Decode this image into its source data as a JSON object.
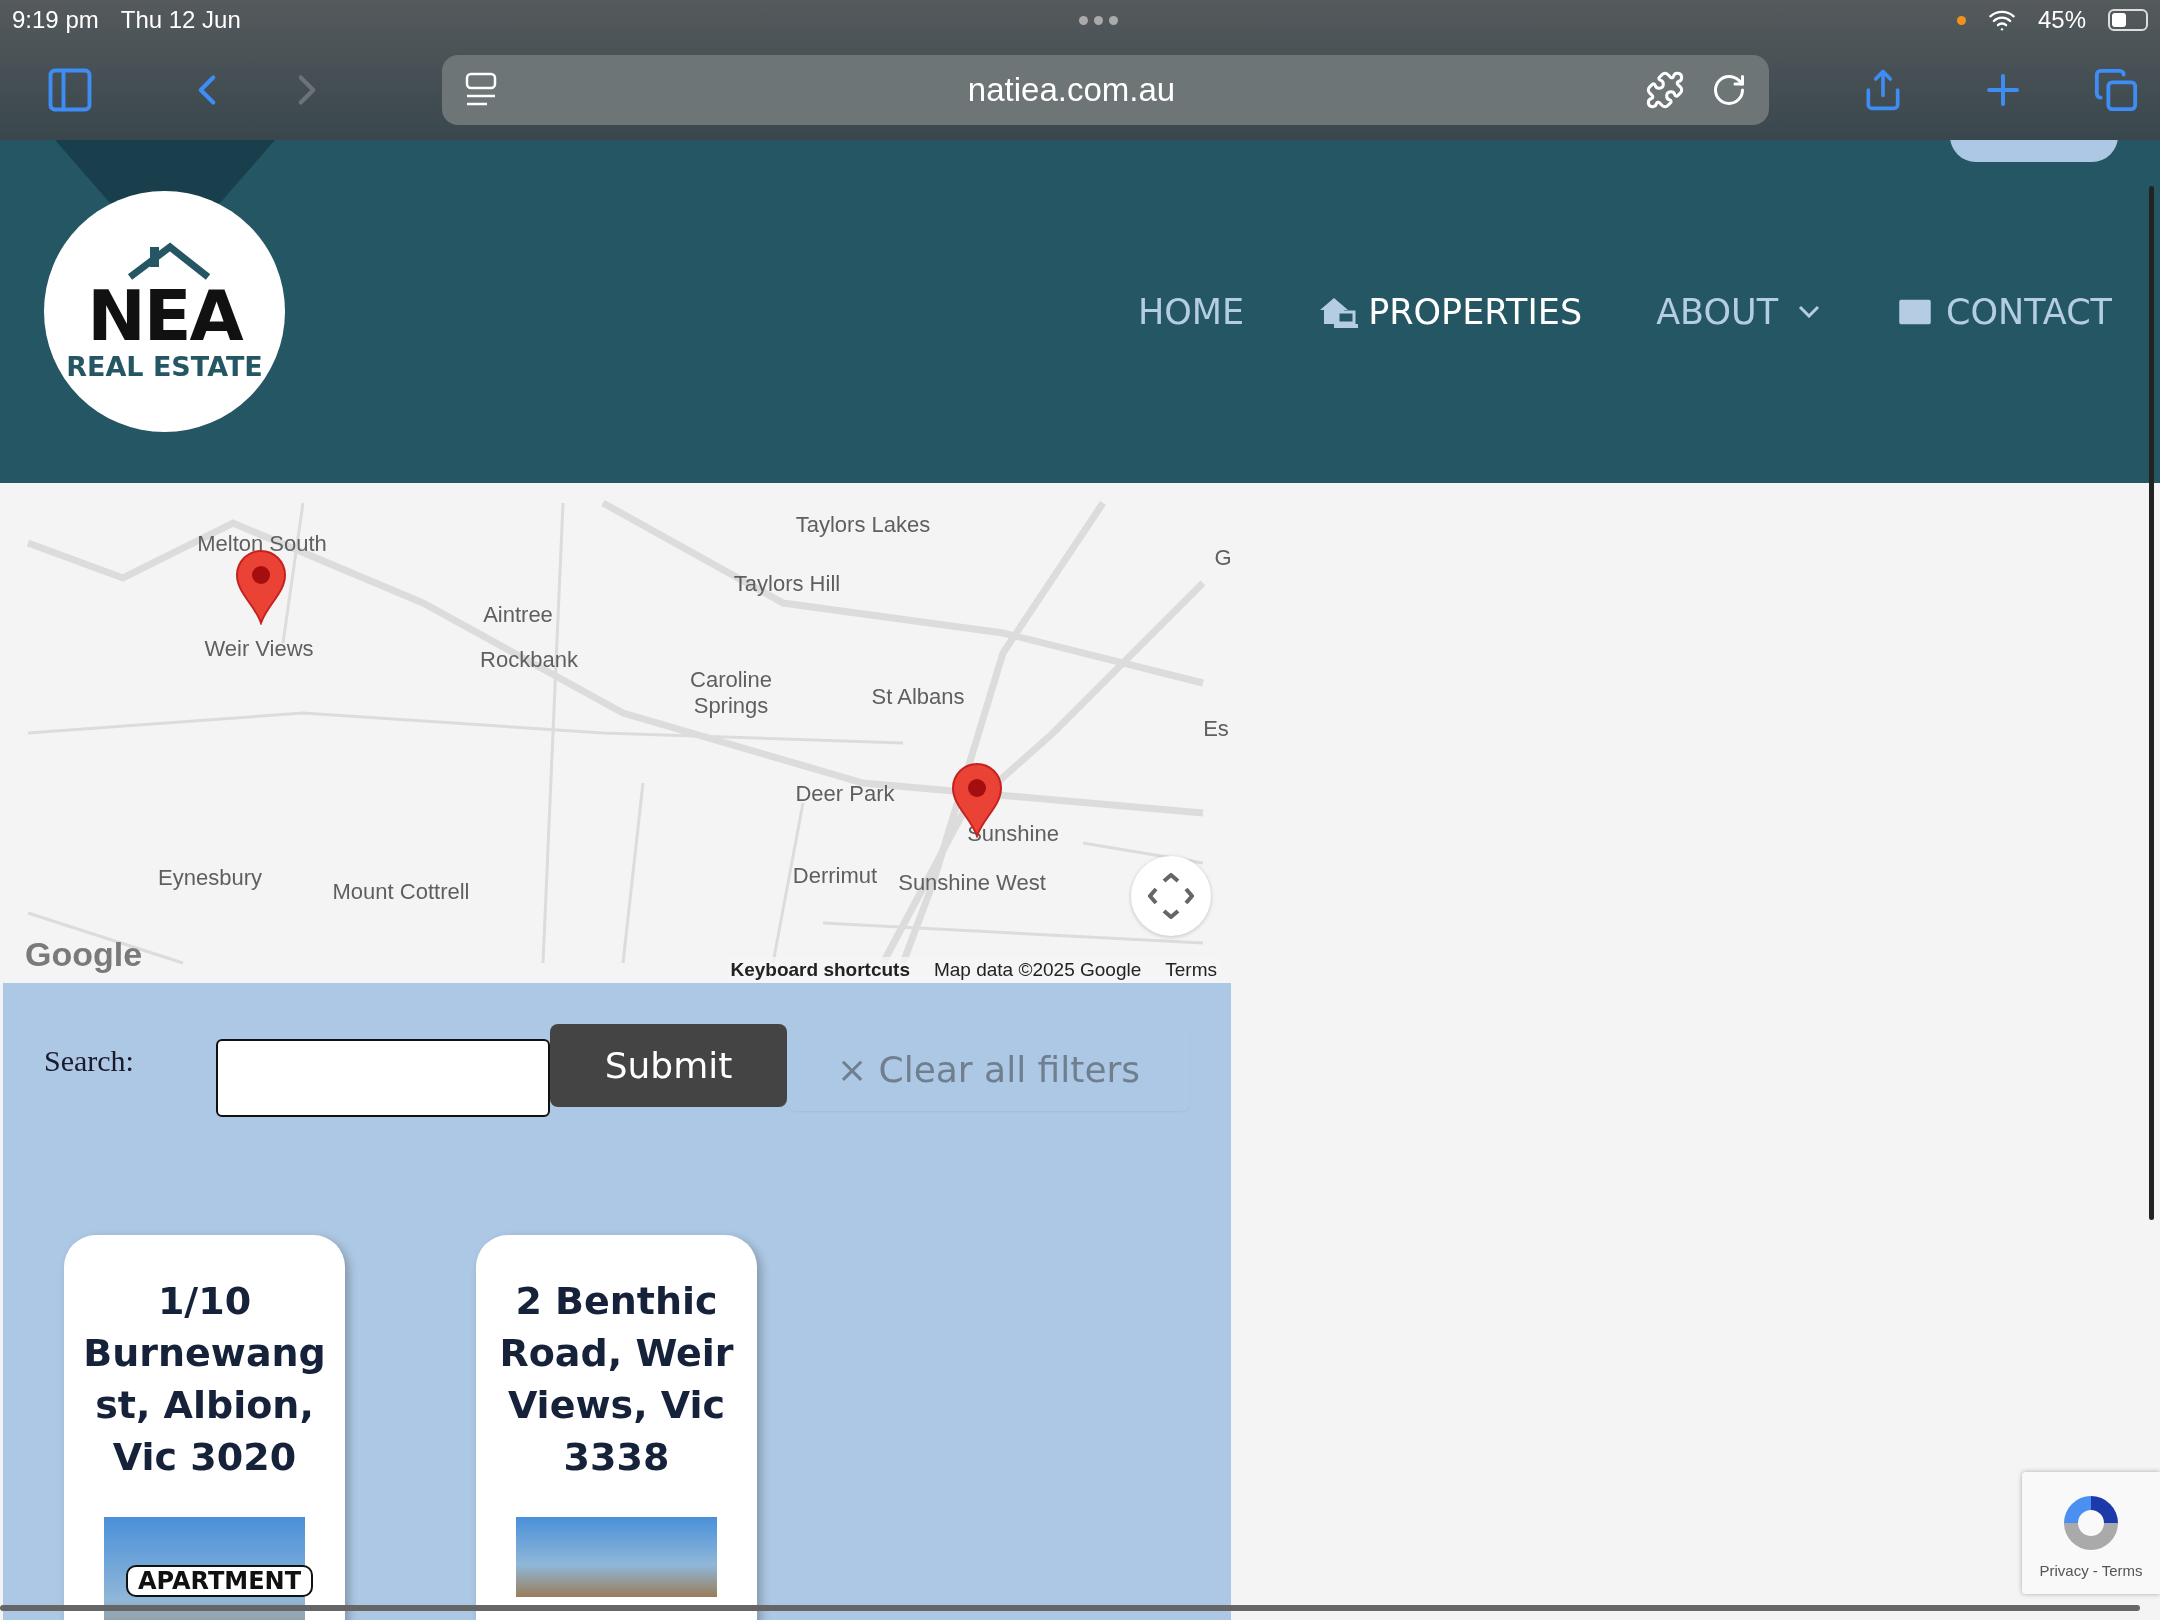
{
  "status_bar": {
    "time": "9:19 pm",
    "date": "Thu 12 Jun",
    "battery": "45%"
  },
  "browser": {
    "url": "natiea.com.au"
  },
  "header": {
    "logo": {
      "name": "NEA",
      "tagline": "REAL ESTATE"
    },
    "nav": [
      {
        "label": "HOME",
        "kind": "link",
        "selected": false
      },
      {
        "label": "PROPERTIES",
        "kind": "link",
        "selected": true
      },
      {
        "label": "ABOUT",
        "kind": "menu",
        "selected": false
      },
      {
        "label": "CONTACT",
        "kind": "link",
        "selected": false
      }
    ]
  },
  "map": {
    "labels": [
      "Taylors Lakes",
      "Melton South",
      "Taylors Hill",
      "Aintree",
      "Weir Views",
      "Rockbank",
      "Caroline Springs",
      "St Albans",
      "Deer Park",
      "Sunshine",
      "Eynesbury",
      "Derrimut",
      "Sunshine West",
      "Mount Cottrell",
      "G",
      "Es"
    ],
    "logo": "Google",
    "footer": [
      "Keyboard shortcuts",
      "Map data ©2025 Google",
      "Terms"
    ]
  },
  "search": {
    "label": "Search:",
    "submit": "Submit",
    "clear": "× Clear all filters"
  },
  "listings": [
    {
      "title": "1/10 Burnewang st, Albion, Vic 3020",
      "tag": "APARTMENT"
    },
    {
      "title": "2 Benthic Road, Weir Views, Vic 3338"
    }
  ],
  "recaptcha": {
    "links": "Privacy - Terms"
  }
}
